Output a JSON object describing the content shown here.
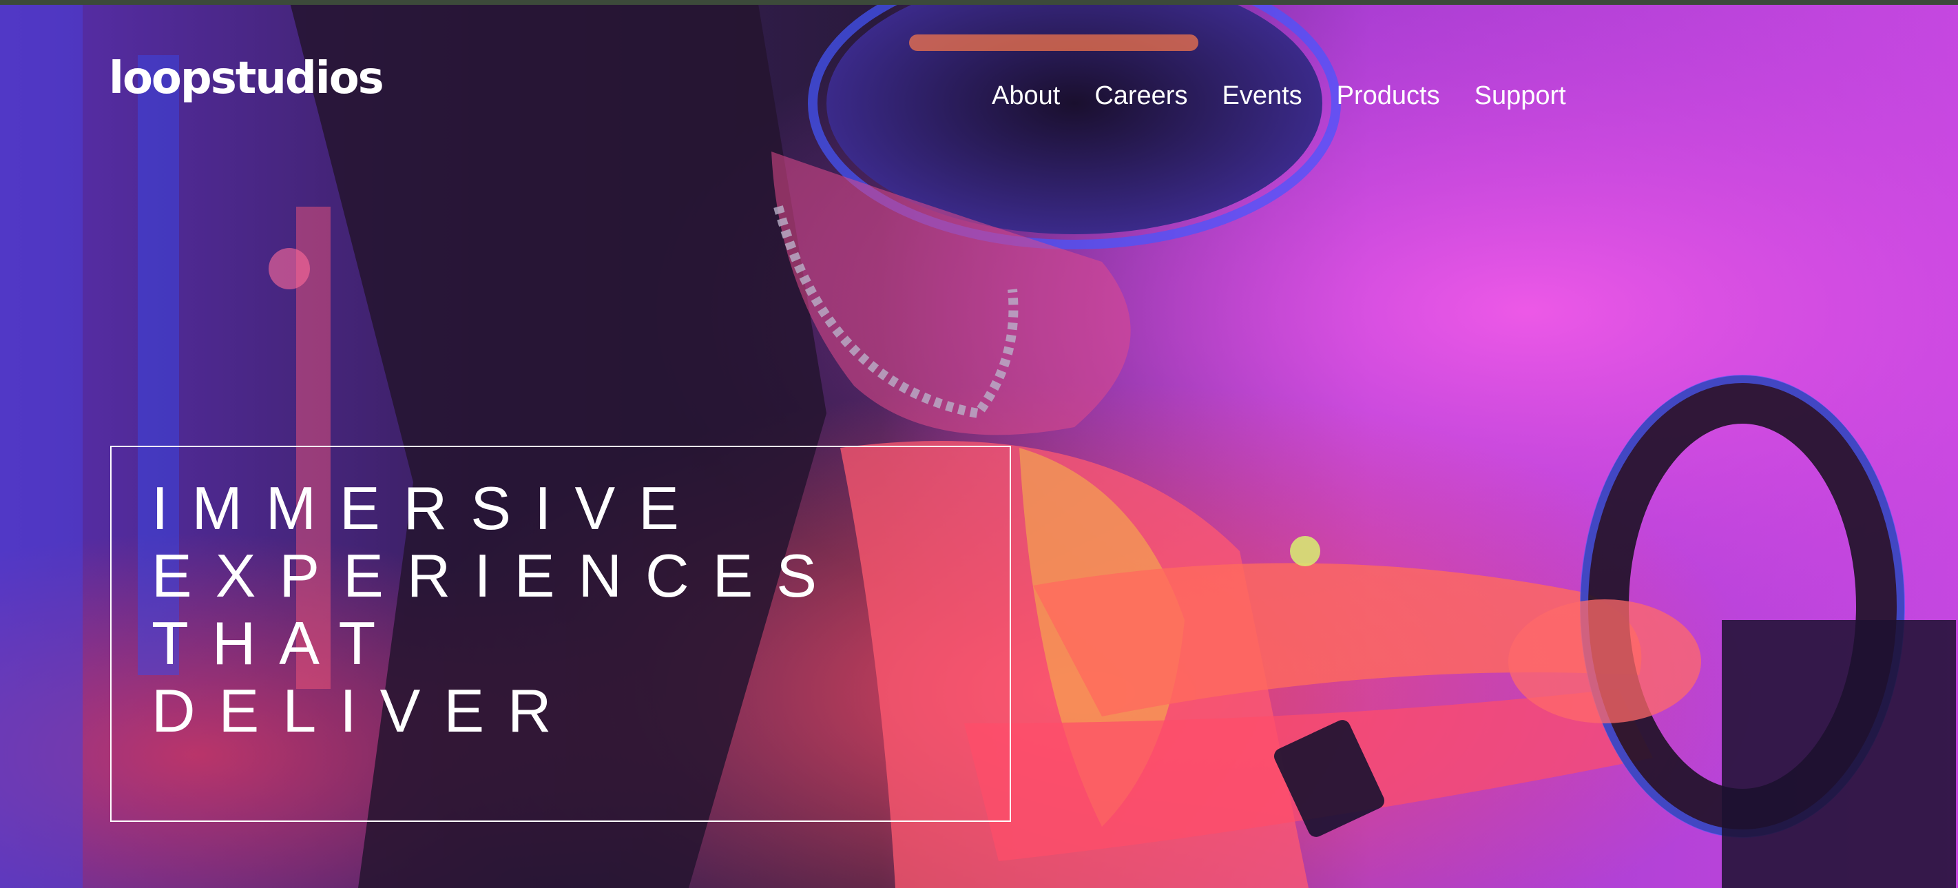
{
  "brand": {
    "logo_text": "loopstudios"
  },
  "nav": {
    "items": [
      {
        "label": "About"
      },
      {
        "label": "Careers"
      },
      {
        "label": "Events"
      },
      {
        "label": "Products"
      },
      {
        "label": "Support"
      }
    ]
  },
  "hero": {
    "headline_lines": [
      "IMMERSIVE",
      "EXPERIENCES",
      "THAT",
      "DELIVER"
    ],
    "background_image": "person wearing a VR headset gripping a racing steering wheel, pink and blue neon lighting"
  },
  "colors": {
    "text": "#ffffff",
    "pink": "#e04ae0",
    "magenta": "#c83bd8",
    "blue": "#3d4fe0",
    "red": "#ff4d6a",
    "dark": "#2a1d3a"
  }
}
